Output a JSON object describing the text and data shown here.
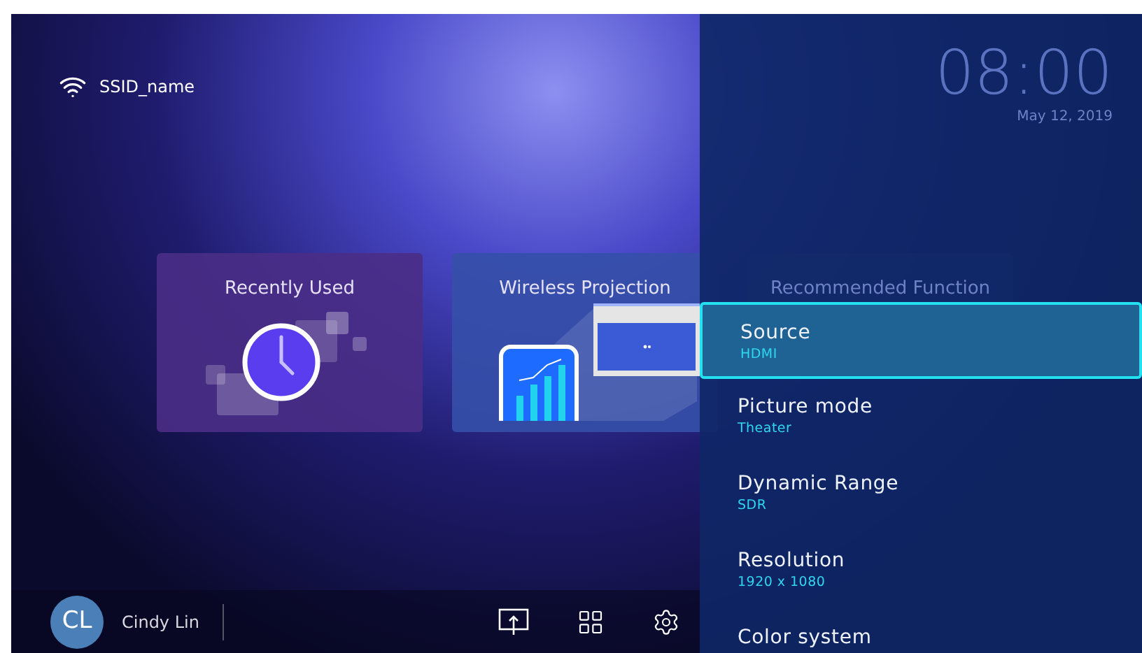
{
  "status": {
    "network_name": "SSID_name"
  },
  "clock": {
    "time": "08:00",
    "date": "May 12, 2019"
  },
  "cards": [
    {
      "title": "Recently Used",
      "kind": "recent"
    },
    {
      "title": "Wireless Projection",
      "kind": "wireless"
    },
    {
      "title": "Recommended Function",
      "kind": "recommended"
    }
  ],
  "user": {
    "initials": "CL",
    "name": "Cindy Lin"
  },
  "settings_menu": [
    {
      "label": "Source",
      "value": "HDMI",
      "selected": true
    },
    {
      "label": "Picture mode",
      "value": "Theater",
      "selected": false
    },
    {
      "label": "Dynamic Range",
      "value": "SDR",
      "selected": false
    },
    {
      "label": "Resolution",
      "value": "1920 x 1080",
      "selected": false
    },
    {
      "label": "Color system",
      "selected": false
    }
  ]
}
